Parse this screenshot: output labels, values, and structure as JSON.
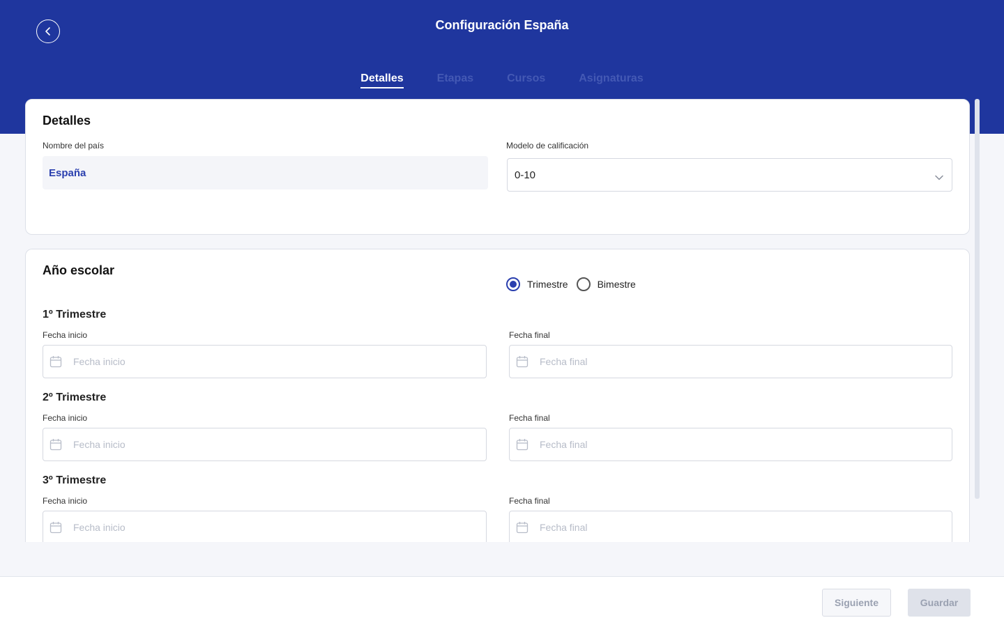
{
  "header": {
    "title": "Configuración España",
    "tabs": [
      {
        "label": "Detalles",
        "active": true
      },
      {
        "label": "Etapas",
        "active": false
      },
      {
        "label": "Cursos",
        "active": false
      },
      {
        "label": "Asignaturas",
        "active": false
      }
    ]
  },
  "details": {
    "title": "Detalles",
    "country_label": "Nombre del país",
    "country_value": "España",
    "grading_label": "Modelo de calificación",
    "grading_value": "0-10"
  },
  "school_year": {
    "title": "Año escolar",
    "options": [
      {
        "label": "Trimestre",
        "checked": true
      },
      {
        "label": "Bimestre",
        "checked": false
      }
    ],
    "periods": [
      {
        "title": "1º Trimestre",
        "start_label": "Fecha inicio",
        "start_placeholder": "Fecha inicio",
        "end_label": "Fecha final",
        "end_placeholder": "Fecha final"
      },
      {
        "title": "2º Trimestre",
        "start_label": "Fecha inicio",
        "start_placeholder": "Fecha inicio",
        "end_label": "Fecha final",
        "end_placeholder": "Fecha final"
      },
      {
        "title": "3º Trimestre",
        "start_label": "Fecha inicio",
        "start_placeholder": "Fecha inicio",
        "end_label": "Fecha final",
        "end_placeholder": "Fecha final"
      }
    ]
  },
  "footer": {
    "next_label": "Siguiente",
    "save_label": "Guardar"
  },
  "colors": {
    "brand": "#1f369e",
    "accent": "#2a3fae",
    "tab_inactive": "#4459b4"
  }
}
